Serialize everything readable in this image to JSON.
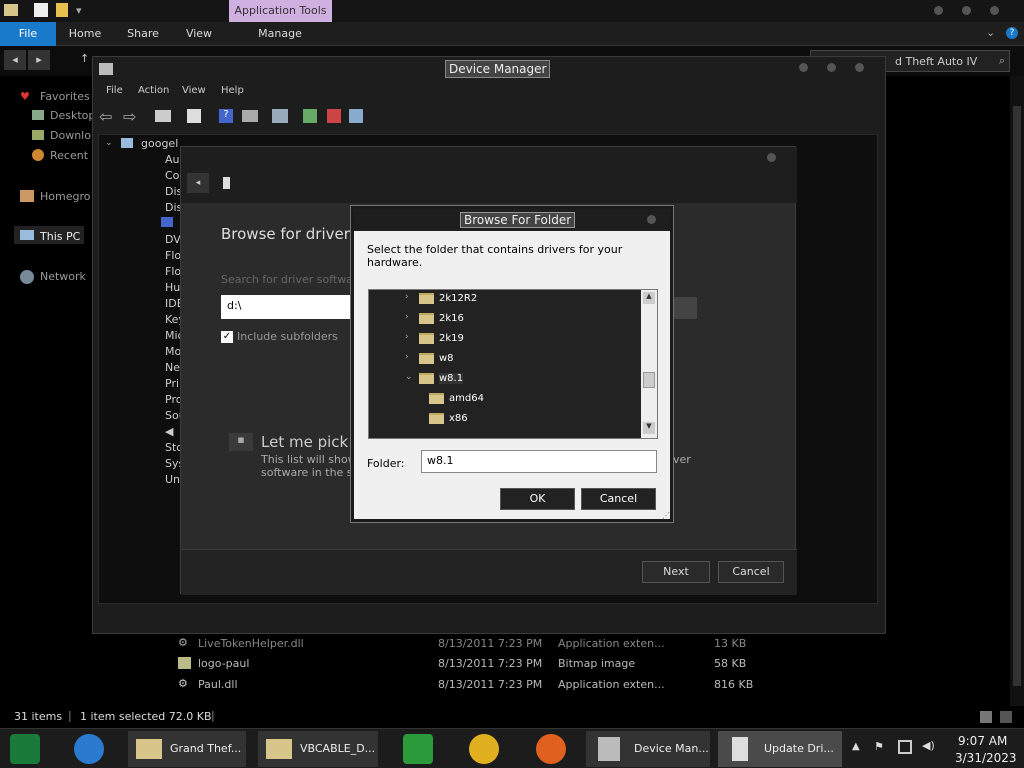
{
  "explorer": {
    "ribbon_context": "Application Tools",
    "tabs": {
      "file": "File",
      "home": "Home",
      "share": "Share",
      "view": "View",
      "manage": "Manage"
    },
    "search_text": "d Theft Auto IV",
    "nav": {
      "favorites": "Favorites",
      "desktop": "Desktop",
      "downloads": "Downlo",
      "recent": "Recent p",
      "homegroup": "Homegro",
      "this_pc": "This PC",
      "network": "Network"
    },
    "files": [
      {
        "name": "LiveTokenHelper.dll",
        "date": "8/13/2011 7:23 PM",
        "type": "Application exten...",
        "size": "13 KB"
      },
      {
        "name": "logo-paul",
        "date": "8/13/2011 7:23 PM",
        "type": "Bitmap image",
        "size": "58 KB"
      },
      {
        "name": "Paul.dll",
        "date": "8/13/2011 7:23 PM",
        "type": "Application exten...",
        "size": "816 KB"
      }
    ],
    "status": {
      "items": "31 items",
      "selected": "1 item selected  72.0 KB"
    }
  },
  "device_manager": {
    "title": "Device Manager",
    "menu": {
      "file": "File",
      "action": "Action",
      "view": "View",
      "help": "Help"
    },
    "root": "googel",
    "nodes": [
      "Aud",
      "Con",
      "Disk",
      "Disp",
      "DVD",
      "Flop",
      "Flop",
      "Hum",
      "IDE",
      "Key",
      "Mic",
      "Mon",
      "Netw",
      "Prin",
      "Proc",
      "Sou",
      "Stor",
      "Syst",
      "Univ"
    ]
  },
  "wizard": {
    "heading": "Browse for driver s",
    "search_label": "Search for driver softwar",
    "path_value": "d:\\",
    "include_subfolders": "Include subfolders",
    "pick_title": "Let me pick f",
    "pick_desc_1": "This list will show",
    "pick_desc_2": "software in the sa",
    "pick_desc_right": "ver",
    "next": "Next",
    "cancel": "Cancel"
  },
  "browse_folder": {
    "title": "Browse For Folder",
    "instruction": "Select the folder that contains drivers for your hardware.",
    "tree": [
      {
        "label": "2k12R2",
        "expanded": false
      },
      {
        "label": "2k16",
        "expanded": false
      },
      {
        "label": "2k19",
        "expanded": false
      },
      {
        "label": "w8",
        "expanded": false
      },
      {
        "label": "w8.1",
        "expanded": true
      },
      {
        "label": "amd64",
        "child": true
      },
      {
        "label": "x86",
        "child": true
      }
    ],
    "folder_label": "Folder:",
    "folder_value": "w8.1",
    "ok": "OK",
    "cancel": "Cancel"
  },
  "taskbar": {
    "apps": [
      {
        "label": "Grand Thef...",
        "icon": "folder-icon"
      },
      {
        "label": "VBCABLE_D...",
        "icon": "folder-icon"
      },
      {
        "label": "Device Man...",
        "icon": "device-manager-icon"
      },
      {
        "label": "Update Dri...",
        "icon": "driver-icon"
      }
    ],
    "time": "9:07 AM",
    "date": "3/31/2023"
  },
  "colors": {
    "accent": "#1979ca",
    "context_tab": "#d0b0e0"
  }
}
